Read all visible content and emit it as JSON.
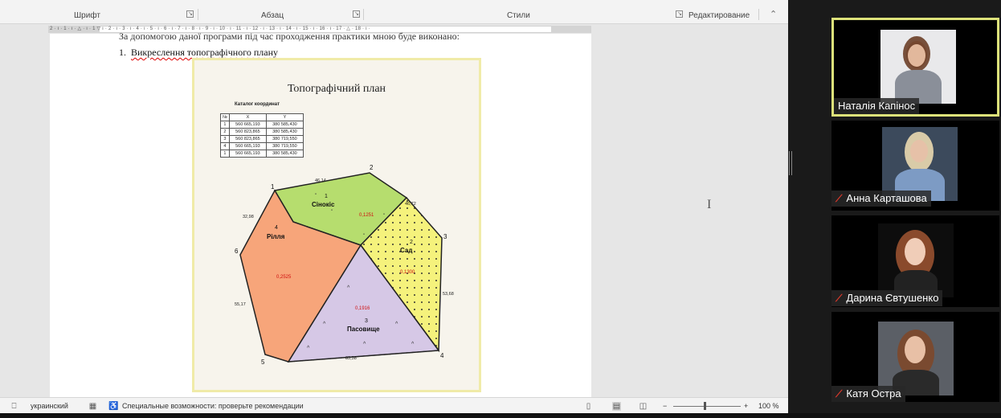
{
  "ribbon": {
    "groups": [
      "Шрифт",
      "Абзац",
      "Стили",
      "Редактирование"
    ]
  },
  "ruler": {
    "ticks": "2 · ı · 1 · ı · △ · ı · 1 ▽ ı · 2 · ı · 3 · ı · 4 · ı · 5 · ı · 6 · ı · 7 · ı · 8 · ı · 9 · ı · 10 · ı · 11 · ı · 12 · ı · 13 · ı · 14 · ı · 15 · ı · 16 · ı · 17 · △ · 18 · ı ·"
  },
  "document": {
    "cut_line": "За допомогою даної програми під час проходження практики мною буде виконано:",
    "list_number": "1.",
    "list_text": "Викреслення топографічного плану"
  },
  "figure": {
    "title": "Топографічний план",
    "catalog_title": "Каталог координат",
    "table_header": [
      "№",
      "X",
      "Y"
    ],
    "table_rows": [
      [
        "1",
        "560 665,193",
        "380 585,430"
      ],
      [
        "2",
        "560 823,865",
        "380 585,430"
      ],
      [
        "3",
        "560 823,865",
        "380 719,550"
      ],
      [
        "4",
        "560 665,193",
        "380 719,550"
      ],
      [
        "1",
        "560 665,193",
        "380 585,430"
      ]
    ],
    "points": [
      "1",
      "2",
      "3",
      "4",
      "5",
      "6"
    ],
    "edge_labels": [
      "46,14",
      "46,72",
      "32,98",
      "55,17",
      "83,38",
      "53,68"
    ],
    "parcels": [
      {
        "name": "Сінокіс",
        "number": "1",
        "area": "0,1251",
        "color": "#b6dd6e"
      },
      {
        "name": "Рілля",
        "number": "4",
        "area": "0,2525",
        "color": "#f7a57a"
      },
      {
        "name": "Сад",
        "number": "2",
        "area": "0,1300",
        "color": "#f5f27c"
      },
      {
        "name": "Пасовище",
        "number": "3",
        "area": "0,1916",
        "color": "#d6c8e6"
      }
    ]
  },
  "status": {
    "language": "украинский",
    "accessibility": "Специальные возможности: проверьте рекомендации",
    "zoom": "100 %",
    "zoom_minus": "−",
    "zoom_plus": "+"
  },
  "participants": [
    {
      "name": "Наталія Капінос",
      "muted": false,
      "active": true
    },
    {
      "name": "Анна Карташова",
      "muted": true,
      "active": false
    },
    {
      "name": "Дарина Євтушенко",
      "muted": true,
      "active": false
    },
    {
      "name": "Катя Остра",
      "muted": true,
      "active": false
    }
  ],
  "colors": {
    "active_speaker_border": "#dde27a",
    "mic_off": "#e0392b"
  }
}
